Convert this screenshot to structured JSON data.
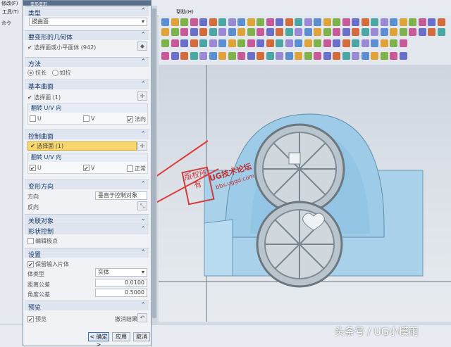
{
  "app": {
    "title_fragment": "修改(F)",
    "tools_menu": "工具(T)",
    "help_menu": "帮助(H)",
    "left_cmd_label": "命令"
  },
  "dialog": {
    "title": "变形变形",
    "sections": {
      "type": {
        "title": "类型",
        "value": "拔曲面"
      },
      "geom": {
        "title": "要变形的几何体",
        "select_text": "选择面或小平面体 (942)"
      },
      "method": {
        "title": "方法",
        "option1": "拉长",
        "option2": "如拉"
      },
      "base": {
        "title": "基本曲面",
        "select_text": "选择面 (1)",
        "flip_label": "翻转 U/V 向",
        "u": "U",
        "v": "V",
        "normal": "法向"
      },
      "control": {
        "title": "控制曲面",
        "select_text": "选择面 (1)",
        "flip_label": "翻转 U/V 向",
        "u": "U",
        "v": "V",
        "normal": "正常"
      },
      "dir": {
        "title": "变形方向",
        "direction_label": "方向",
        "direction_value": "垂直于控制对象",
        "reverse_label": "反向"
      },
      "assoc": {
        "title": "关联对象"
      },
      "shape": {
        "title": "形状控制",
        "edit_poles": "编辑极点"
      },
      "settings": {
        "title": "设置",
        "keep_input": "保留输入片体",
        "body_type_label": "体类型",
        "body_type_value": "实体",
        "dist_tol_label": "距离公差",
        "dist_tol_value": "0.0100",
        "angle_tol_label": "角度公差",
        "angle_tol_value": "0.5000"
      },
      "preview": {
        "title": "预览",
        "preview_label": "预览",
        "undo_label": "撤消结果"
      }
    },
    "buttons": {
      "ok": "< 确定 >",
      "apply": "应用",
      "cancel": "取消"
    }
  },
  "overlay": {
    "stamp_text": "版权所有",
    "forum_name": "UG技术论坛",
    "forum_url": "bbs.uggd.com",
    "watermark": "头条号 / UG小模雨"
  }
}
